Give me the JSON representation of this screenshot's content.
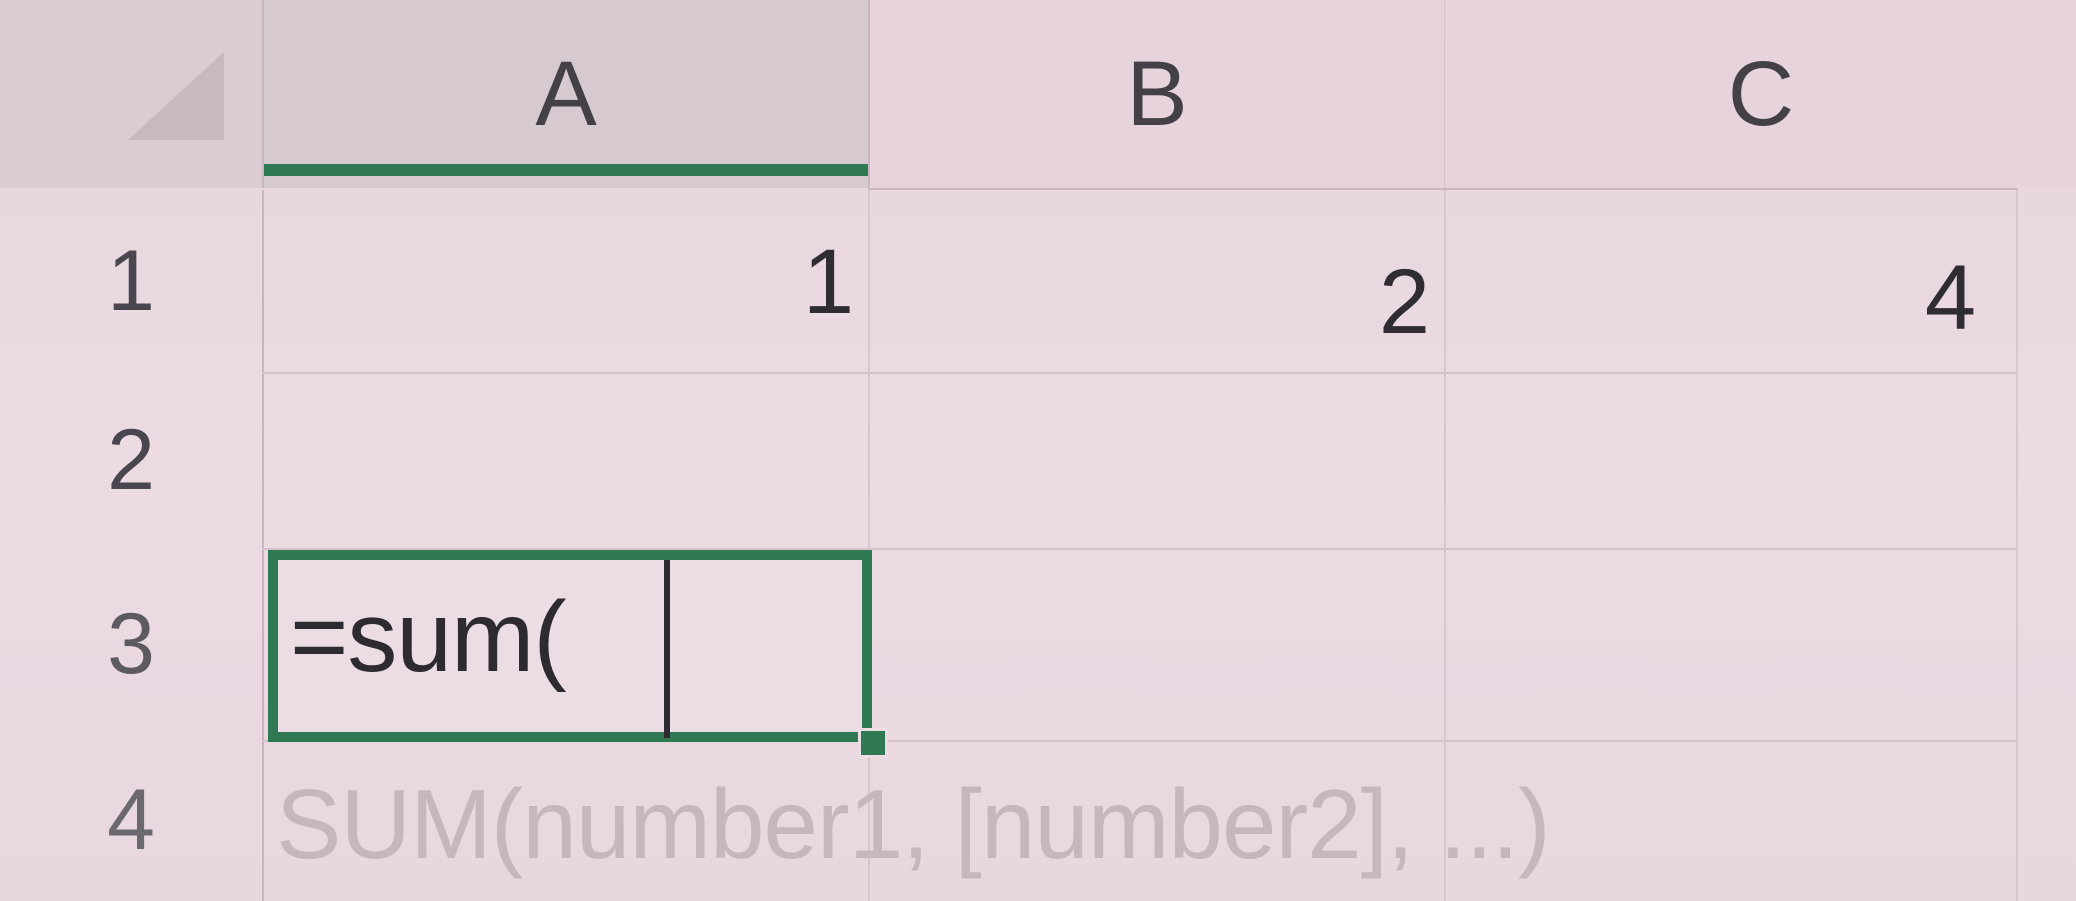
{
  "columns": {
    "a": "A",
    "b": "B",
    "c": "C"
  },
  "rows": {
    "r1": "1",
    "r2": "2",
    "r3": "3",
    "r4": "4"
  },
  "cells": {
    "a1": "1",
    "b1": "2",
    "c1": "4"
  },
  "active_cell": {
    "formula": "=sum("
  },
  "tooltip": {
    "signature": "SUM(number1, [number2], ...)"
  },
  "colors": {
    "selection": "#2f7a52"
  }
}
